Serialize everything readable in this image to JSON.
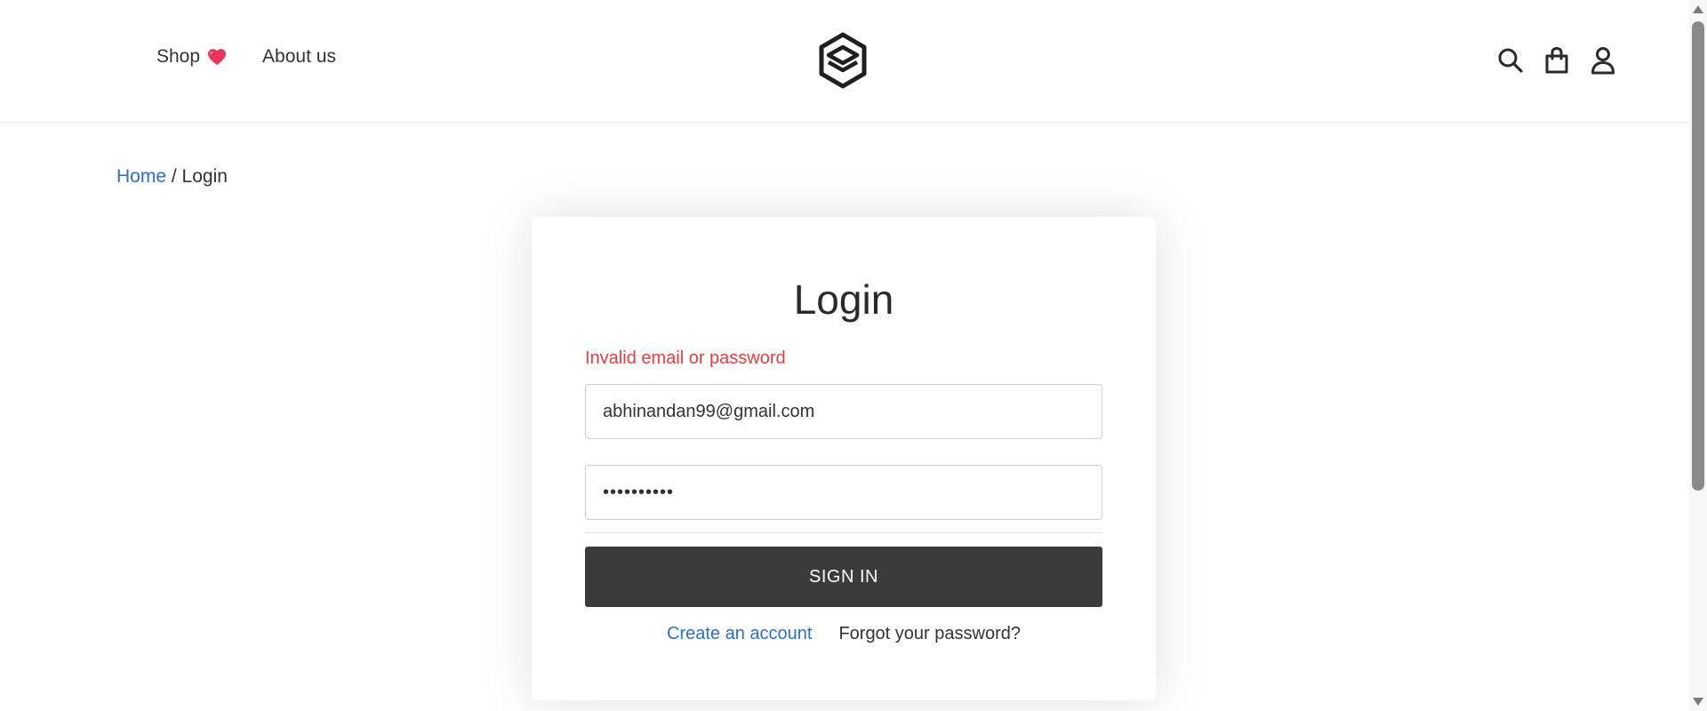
{
  "header": {
    "nav_left": [
      {
        "label": "Shop",
        "icon": "heart-icon"
      },
      {
        "label": "About us"
      }
    ],
    "logo_icon": "layers-logo-icon",
    "nav_right_icons": [
      "search-icon",
      "shopping-bag-icon",
      "user-icon"
    ]
  },
  "breadcrumb": {
    "home": "Home",
    "separator": " / ",
    "current": "Login"
  },
  "login": {
    "title": "Login",
    "error": "Invalid email or password",
    "email_value": "abhinandan99@gmail.com",
    "password_value": "••••••••••",
    "signin_label": "SIGN IN",
    "create_account": "Create an account",
    "forgot_password": "Forgot your password?"
  },
  "colors": {
    "link": "#2f6fc4",
    "error": "#e53e3e",
    "button": "#3b3b3b",
    "heart": "#e8345a"
  }
}
